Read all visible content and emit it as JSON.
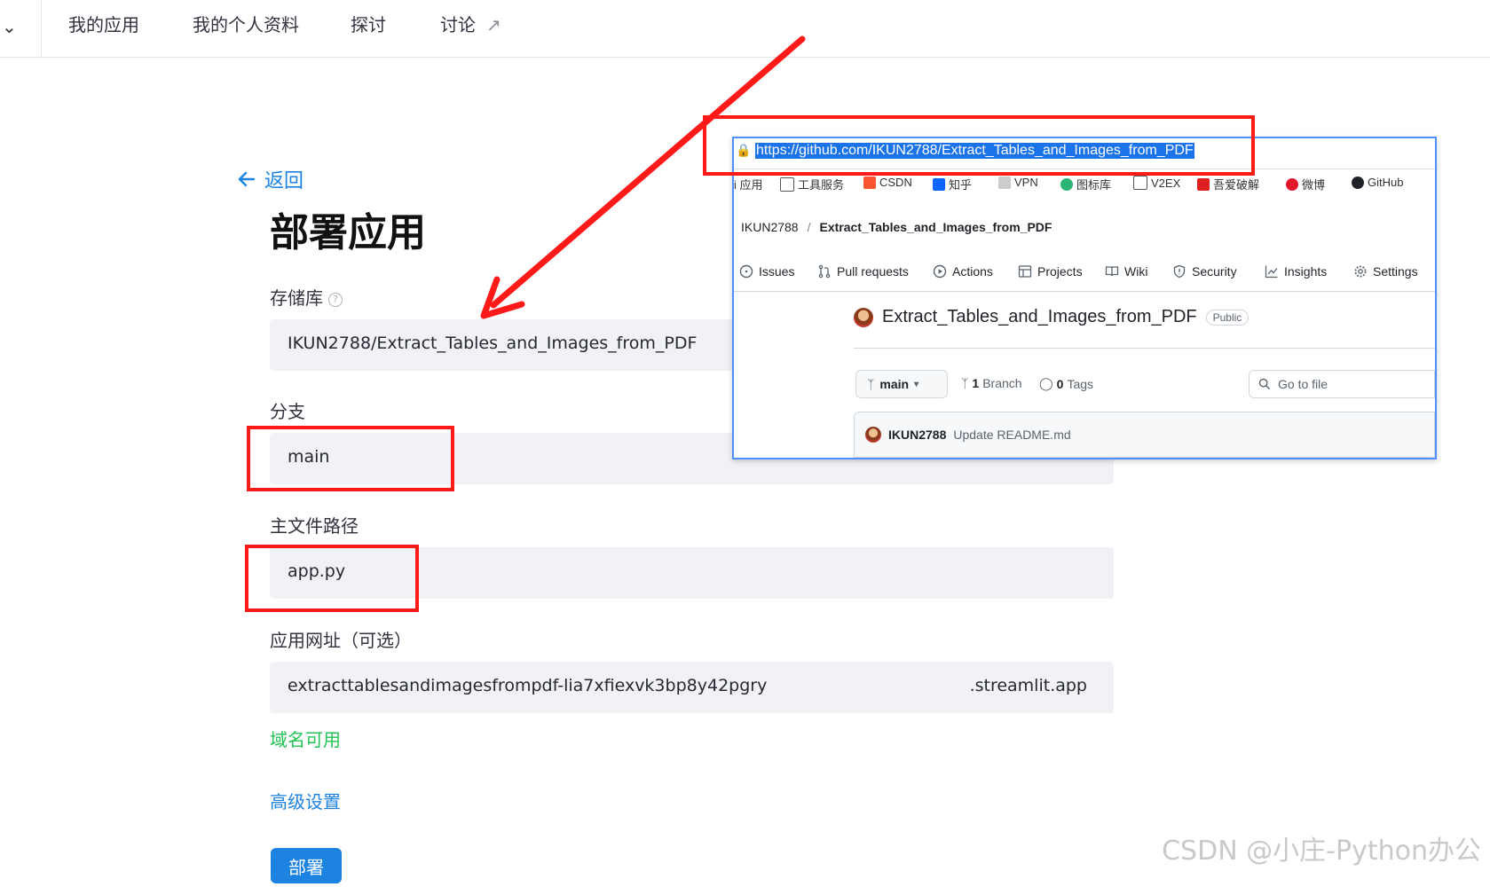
{
  "topnav": {
    "items": [
      "我的应用",
      "我的个人资料",
      "探讨",
      "讨论"
    ]
  },
  "form": {
    "back_label": "返回",
    "title": "部署应用",
    "repo_label": "存储库",
    "repo_value": "IKUN2788/Extract_Tables_and_Images_from_PDF",
    "branch_label": "分支",
    "branch_value": "main",
    "main_file_label": "主文件路径",
    "main_file_value": "app.py",
    "app_url_label": "应用网址（可选）",
    "app_url_value": "extracttablesandimagesfrompdf-lia7xfiexvk3bp8y42pgry",
    "app_url_suffix": ".streamlit.app",
    "domain_status": "域名可用",
    "advanced_link": "高级设置",
    "deploy_button": "部署"
  },
  "browser": {
    "url": "https://github.com/IKUN2788/Extract_Tables_and_Images_from_PDF",
    "bookmarks": [
      "i 应用",
      "工具服务",
      "CSDN",
      "知乎",
      "VPN",
      "图标库",
      "V2EX",
      "吾爱破解",
      "微博",
      "GitHub"
    ],
    "breadcrumb_owner": "IKUN2788",
    "breadcrumb_sep": "/",
    "breadcrumb_repo": "Extract_Tables_and_Images_from_PDF",
    "tabs": [
      "Issues",
      "Pull requests",
      "Actions",
      "Projects",
      "Wiki",
      "Security",
      "Insights",
      "Settings"
    ],
    "repo_name": "Extract_Tables_and_Images_from_PDF",
    "visibility": "Public",
    "branch": "main",
    "branch_count": "1",
    "branch_word": "Branch",
    "tag_count": "0",
    "tag_word": "Tags",
    "go_to_file": "Go to file",
    "commit_author": "IKUN2788",
    "commit_message": "Update README.md"
  },
  "watermark": "CSDN @小庄-Python办公",
  "colors": {
    "accent": "#1c83e1",
    "annotation_red": "#ff1a1a",
    "success_green": "#21c354",
    "field_bg": "#f0f2f6"
  }
}
